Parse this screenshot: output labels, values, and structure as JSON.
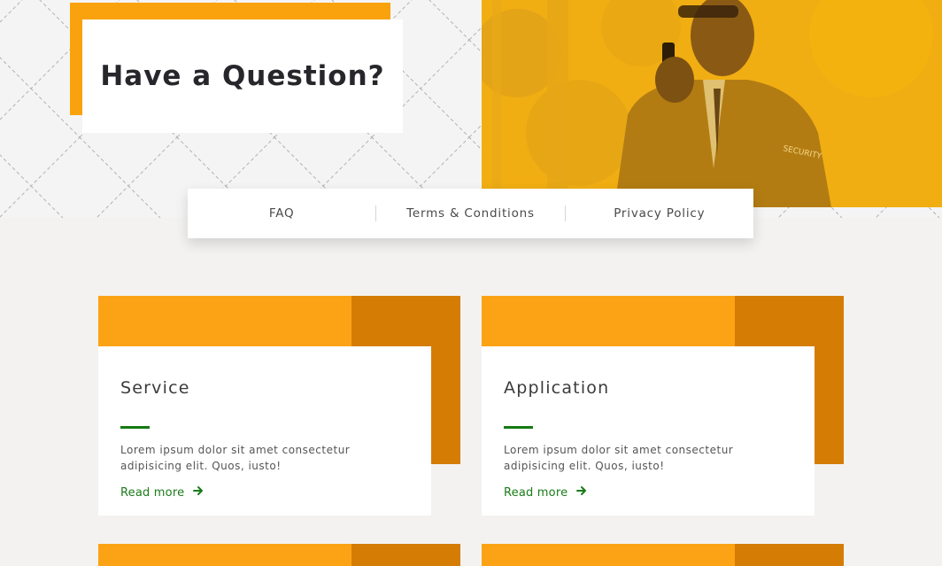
{
  "hero": {
    "title": "Have a Question?",
    "photo_tint": "#f2b114",
    "accent_color": "#f9a20e",
    "badge_text": "SECURITY"
  },
  "tabs": [
    {
      "label": "FAQ"
    },
    {
      "label": "Terms & Conditions"
    },
    {
      "label": "Privacy Policy"
    }
  ],
  "cards": [
    {
      "title": "Service",
      "text_line1": "Lorem ipsum dolor sit amet consectetur",
      "text_line2": "adipisicing elit. Quos, iusto!",
      "link_label": "Read more",
      "link_icon": "arrow-right-icon"
    },
    {
      "title": "Application",
      "text_line1": "Lorem ipsum dolor sit amet consectetur",
      "text_line2": "adipisicing elit. Quos, iusto!",
      "link_label": "Read more",
      "link_icon": "arrow-right-icon"
    }
  ],
  "colors": {
    "card_light": "#fca315",
    "card_dark": "#d57c05",
    "link_green": "#1a7b18"
  }
}
